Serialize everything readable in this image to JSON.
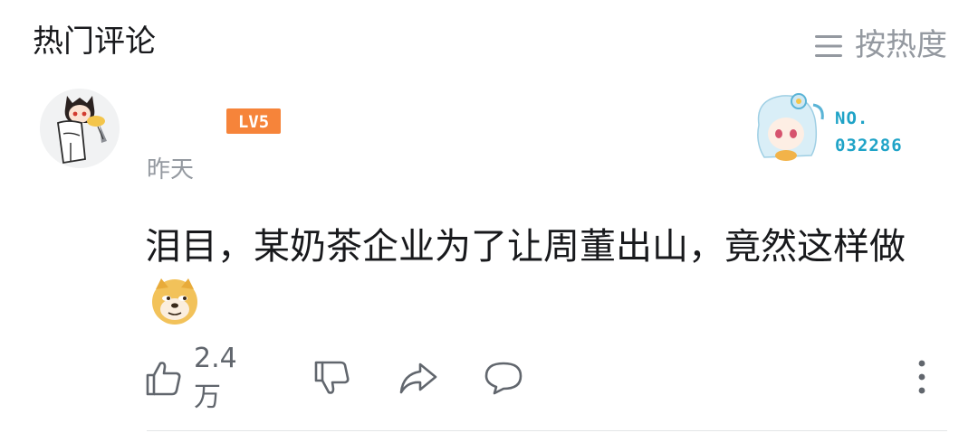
{
  "header": {
    "title": "热门评论",
    "sort_icon": "menu-lines-icon",
    "sort_label": "按热度"
  },
  "comment": {
    "avatar_icon": "cartoon-avatar",
    "level_badge": "LV5",
    "timestamp": "昨天",
    "fan_badge": {
      "icon": "anime-girl-badge",
      "label": "NO.",
      "number": "032286"
    },
    "text": "泪目，某奶茶企业为了让周董出山，竟然这样做",
    "emoji_icon": "doge-emoji",
    "actions": {
      "like_icon": "thumbs-up-icon",
      "like_count": "2.4万",
      "dislike_icon": "thumbs-down-icon",
      "share_icon": "share-icon",
      "reply_icon": "reply-bubble-icon",
      "more_icon": "more-vertical-icon"
    }
  },
  "colors": {
    "text_primary": "#18191c",
    "text_secondary": "#9499a0",
    "level_orange": "#f6843a",
    "fan_blue": "#1fa3c7",
    "divider": "#e3e5e7"
  }
}
